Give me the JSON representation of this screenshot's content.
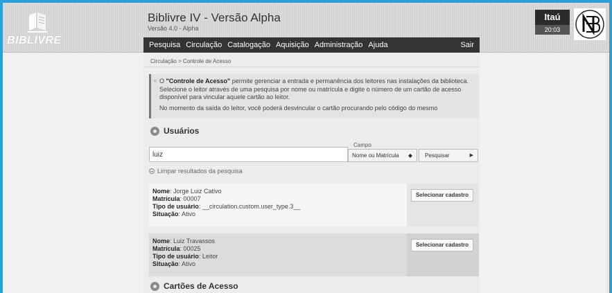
{
  "header": {
    "logo_text": "BIBLIVRE",
    "app_title": "Biblivre IV - Versão Alpha",
    "app_version": "Versão 4.0 - Alpha",
    "bank_name": "Itaú",
    "time": "20:03"
  },
  "menu": {
    "items": [
      "Pesquisa",
      "Circulação",
      "Catalogação",
      "Aquisição",
      "Administração",
      "Ajuda"
    ],
    "logout": "Sair"
  },
  "breadcrumb": "Circulação > Controle de Acesso",
  "notice": {
    "close": "×",
    "line1_prefix": "O ",
    "line1_bold": "\"Controle de Acesso\"",
    "line1_rest": " permite gerenciar a entrada e permanência dos leitores nas instalações da biblioteca. Selecione o leitor através de uma pesquisa por nome ou matrícula e digite o número de um cartão de acesso disponível para vincular aquele cartão ao leitor.",
    "line2": "No momento da saída do leitor, você poderá desvincular o cartão procurando pelo código do mesmo"
  },
  "users_section": {
    "title": "Usuários",
    "search_value": "luiz",
    "field_label": "Campo",
    "field_value": "Nome ou Matrícula",
    "search_button": "Pesquisar",
    "clear_label": "Limpar resultados da pesquisa"
  },
  "results": [
    {
      "nome_label": "Nome",
      "nome": ": Jorge Luiz Cativo",
      "matricula_label": "Matrícula",
      "matricula": ": 00007",
      "tipo_label": "Tipo de usuário",
      "tipo": ": __circulation.custom.user_type.3__",
      "situacao_label": "Situação",
      "situacao": ": Ativo",
      "button": "Selecionar cadastro"
    },
    {
      "nome_label": "Nome",
      "nome": ": Luiz Travassos",
      "matricula_label": "Matrícula",
      "matricula": ": 00025",
      "tipo_label": "Tipo de usuário",
      "tipo": ": Leitor",
      "situacao_label": "Situação",
      "situacao": ": Ativo",
      "button": "Selecionar cadastro"
    }
  ],
  "cards_section": {
    "title": "Cartões de Acesso"
  },
  "colors": {
    "frame_border": "#2a9fd8",
    "menubar": "#333333",
    "content_bg": "#ececec"
  },
  "icons": [
    "library-logo-icon",
    "location-pin-icon",
    "minus-circle-icon",
    "select-arrows-icon",
    "triangle-right-icon",
    "seal-monogram-icon"
  ]
}
